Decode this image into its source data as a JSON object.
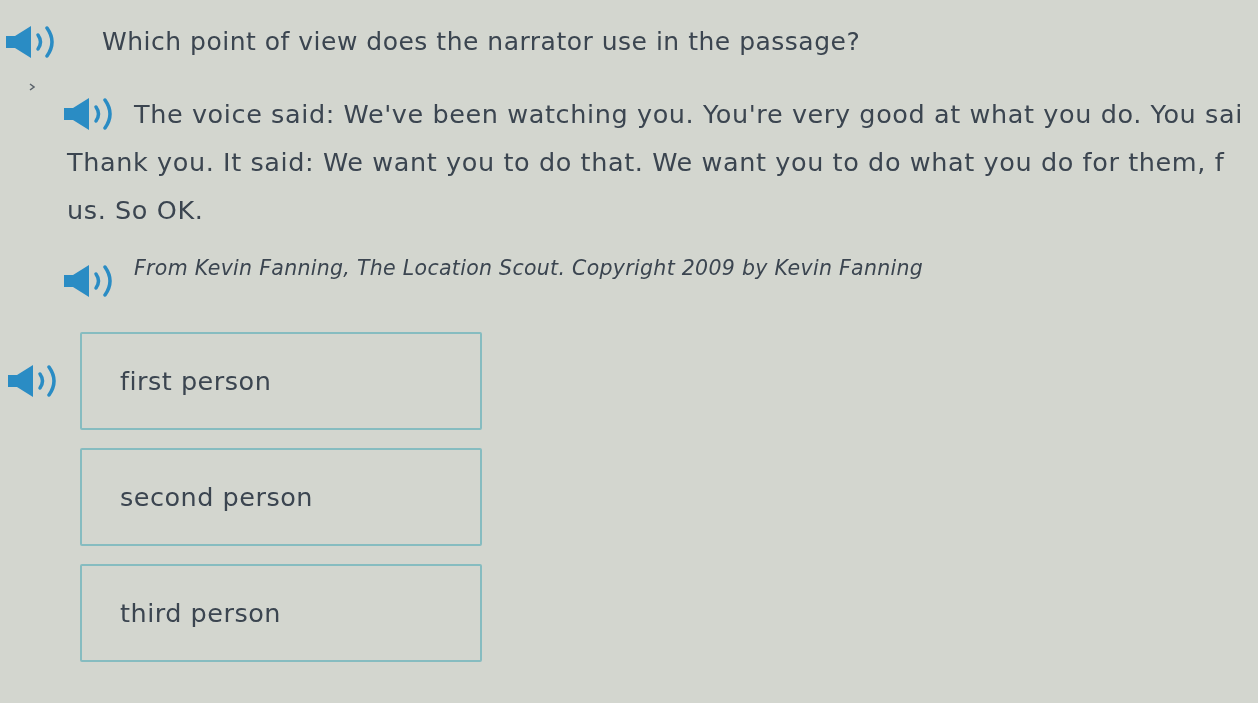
{
  "question": {
    "text": "Which point of view does the narrator use in the passage?"
  },
  "passage": {
    "lines": [
      "The voice said: We've been watching you. You're very good at what you do. You sai",
      "Thank you. It said: We want you to do that. We want you to do what you do for them, f",
      "us. So OK."
    ]
  },
  "source": {
    "text": "From Kevin Fanning, The Location Scout. Copyright 2009 by Kevin Fanning"
  },
  "options": [
    {
      "label": "first person",
      "selected": false
    },
    {
      "label": "second person",
      "selected": false
    },
    {
      "label": "third person",
      "selected": false
    }
  ]
}
